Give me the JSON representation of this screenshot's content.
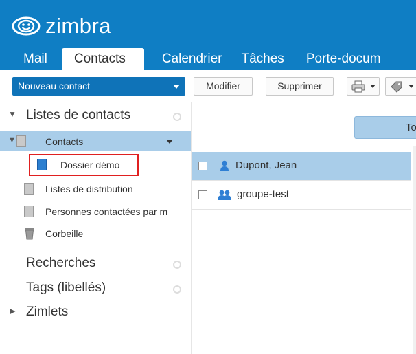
{
  "app": {
    "logo_text": "zimbra"
  },
  "tabs": [
    {
      "label": "Mail",
      "active": false
    },
    {
      "label": "Contacts",
      "active": true
    },
    {
      "label": "Calendrier",
      "active": false
    },
    {
      "label": "Tâches",
      "active": false
    },
    {
      "label": "Porte-docum",
      "active": false
    }
  ],
  "toolbar": {
    "new_label": "Nouveau contact",
    "edit_label": "Modifier",
    "delete_label": "Supprimer"
  },
  "sidebar": {
    "section_lists": "Listes de contacts",
    "items": [
      {
        "label": "Contacts",
        "icon": "address-book-icon",
        "selected": true
      },
      {
        "label": "Dossier démo",
        "icon": "address-book-icon",
        "highlighted": true
      },
      {
        "label": "Listes de distribution",
        "icon": "address-book-icon"
      },
      {
        "label": "Personnes contactées par m",
        "icon": "address-book-icon"
      },
      {
        "label": "Corbeille",
        "icon": "trash-icon"
      }
    ],
    "section_searches": "Recherches",
    "section_tags": "Tags (libellés)",
    "section_zimlets": "Zimlets"
  },
  "main": {
    "top_button_label": "To",
    "contacts": [
      {
        "name": "Dupont, Jean",
        "icon": "person-icon",
        "selected": true
      },
      {
        "name": "groupe-test",
        "icon": "group-icon",
        "selected": false
      }
    ]
  },
  "colors": {
    "brand": "#0f7ec4",
    "selection": "#a9cde9",
    "highlight_border": "#e02020"
  }
}
